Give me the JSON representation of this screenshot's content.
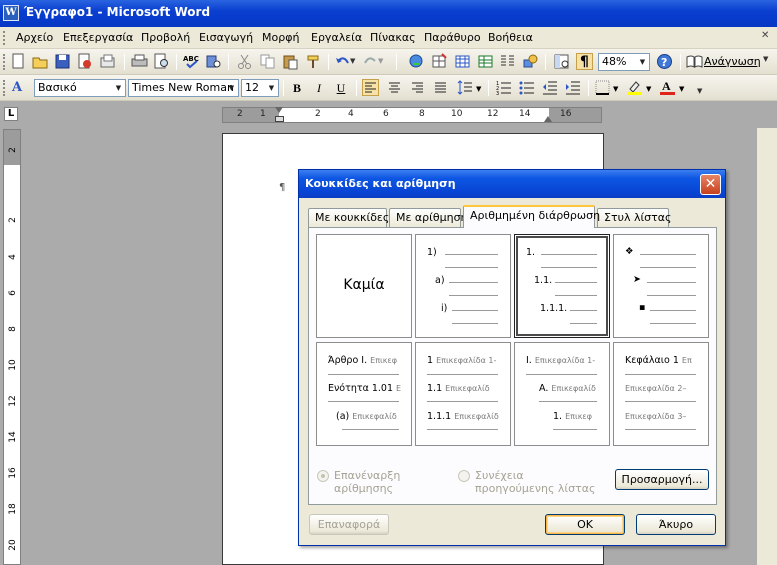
{
  "window": {
    "title": "Έγγραφο1 - Microsoft Word"
  },
  "menu": [
    "Αρχείο",
    "Επεξεργασία",
    "Προβολή",
    "Εισαγωγή",
    "Μορφή",
    "Εργαλεία",
    "Πίνακας",
    "Παράθυρο",
    "Βοήθεια"
  ],
  "standard_toolbar": {
    "zoom": "48%",
    "reading_label": "Ανάγνωση"
  },
  "formatting_toolbar": {
    "style": "Βασικό",
    "font": "Times New Roman",
    "size": "12",
    "bold": "B",
    "italic": "I",
    "underline": "U"
  },
  "ruler": {
    "h_labels": [
      "2",
      "1",
      "2",
      "4",
      "6",
      "8",
      "10",
      "12",
      "14",
      "16"
    ],
    "v_labels": [
      "2",
      "2",
      "4",
      "6",
      "8",
      "10",
      "12",
      "14",
      "16",
      "18",
      "20"
    ],
    "corner": "L"
  },
  "document": {
    "pilcrow": "¶"
  },
  "dialog": {
    "title": "Κουκκίδες και αρίθμηση",
    "close": "✕",
    "tabs": [
      "Με κουκκίδες",
      "Με αρίθμηση",
      "Αριθμημένη διάρθρωση",
      "Στυλ λίστας"
    ],
    "active_tab": "Αριθμημένη διάρθρωση",
    "gallery": {
      "none": "Καμία",
      "c2": [
        "1)",
        "a)",
        "i)"
      ],
      "c3": [
        "1.",
        "1.1.",
        "1.1.1."
      ],
      "c4": [
        "❖",
        "➤",
        "▪"
      ],
      "c5": [
        {
          "head": "Άρθρο Ι.",
          "rest": "Επικεφ"
        },
        {
          "head": "Ενότητα 1.01",
          "rest": "Ε"
        },
        {
          "head": "(a)",
          "rest": "Επικεφαλίδ"
        }
      ],
      "c6": [
        {
          "head": "1",
          "rest": "Επικεφαλίδα 1-"
        },
        {
          "head": "1.1",
          "rest": "Επικεφαλίδ"
        },
        {
          "head": "1.1.1",
          "rest": "Επικεφαλίδ"
        }
      ],
      "c7": [
        {
          "head": "I.",
          "rest": "Επικεφαλίδα 1-"
        },
        {
          "head": "A.",
          "rest": "Επικεφαλίδ"
        },
        {
          "head": "1.",
          "rest": "Επικεφ"
        }
      ],
      "c8": [
        {
          "head": "Κεφάλαιο 1",
          "rest": "Επ"
        },
        {
          "head": "",
          "rest": "Επικεφαλίδα 2–"
        },
        {
          "head": "",
          "rest": "Επικεφαλίδα 3–"
        }
      ]
    },
    "radio_restart": "Επανέναρξη αρίθμησης",
    "radio_continue_1": "Συνέχεια",
    "radio_continue_2": "προηγούμενης λίστας",
    "customize": "Προσαρμογή...",
    "reset": "Επαναφορά",
    "ok": "ΟΚ",
    "cancel": "Άκυρο"
  }
}
